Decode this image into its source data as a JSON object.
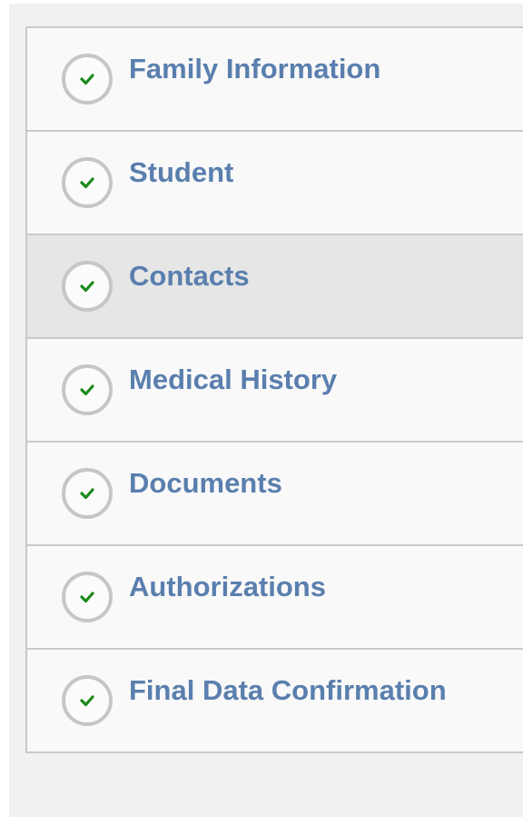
{
  "steps": [
    {
      "label": "Family Information",
      "status": "complete",
      "active": false
    },
    {
      "label": "Student",
      "status": "complete",
      "active": false
    },
    {
      "label": "Contacts",
      "status": "complete",
      "active": true
    },
    {
      "label": "Medical History",
      "status": "complete",
      "active": false
    },
    {
      "label": "Documents",
      "status": "complete",
      "active": false
    },
    {
      "label": "Authorizations",
      "status": "complete",
      "active": false
    },
    {
      "label": "Final Data Confirmation",
      "status": "complete",
      "active": false
    }
  ],
  "icons": {
    "complete": "checkmark-circle-icon"
  },
  "colors": {
    "label": "#5a7fae",
    "check": "#1a8a1a",
    "active_bg": "#e6e6e6"
  }
}
